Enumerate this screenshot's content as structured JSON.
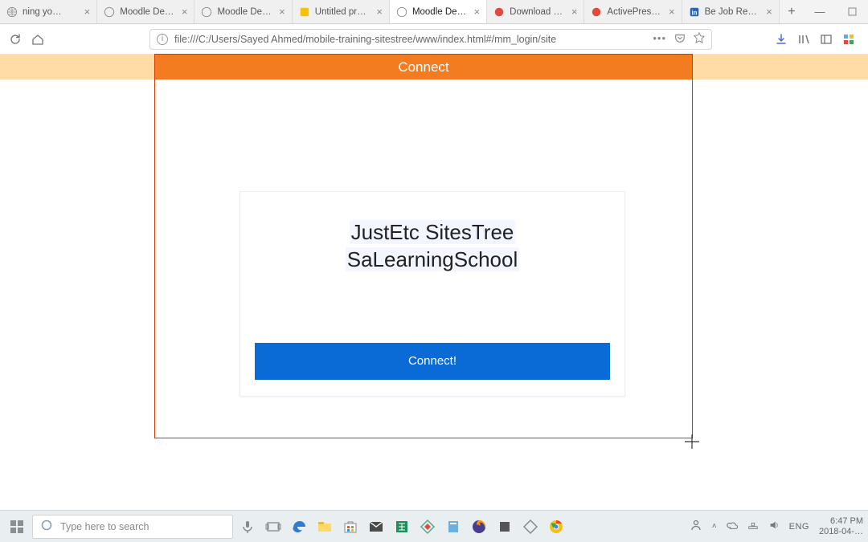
{
  "browser": {
    "tabs": [
      {
        "label": "ning yo…",
        "icon": "globe"
      },
      {
        "label": "Moodle Desktop",
        "icon": "globe"
      },
      {
        "label": "Moodle Desktop",
        "icon": "globe"
      },
      {
        "label": "Untitled presen…",
        "icon": "slides"
      },
      {
        "label": "Moodle Desktop",
        "icon": "globe",
        "active": true
      },
      {
        "label": "Download - At…",
        "icon": "atomi"
      },
      {
        "label": "ActivePresente…",
        "icon": "atomi"
      },
      {
        "label": "Be Job Ready",
        "icon": "linkedin"
      }
    ],
    "url": "file:///C:/Users/Sayed Ahmed/mobile-training-sitestree/www/index.html#/mm_login/site"
  },
  "app": {
    "header": "Connect",
    "title_line1": "JustEtc  SitesTree",
    "title_line2": "SaLearningSchool",
    "connect_label": "Connect!"
  },
  "taskbar": {
    "search_placeholder": "Type here to search",
    "lang": "ENG",
    "time": "6:47 PM",
    "date": "2018-04-…"
  }
}
